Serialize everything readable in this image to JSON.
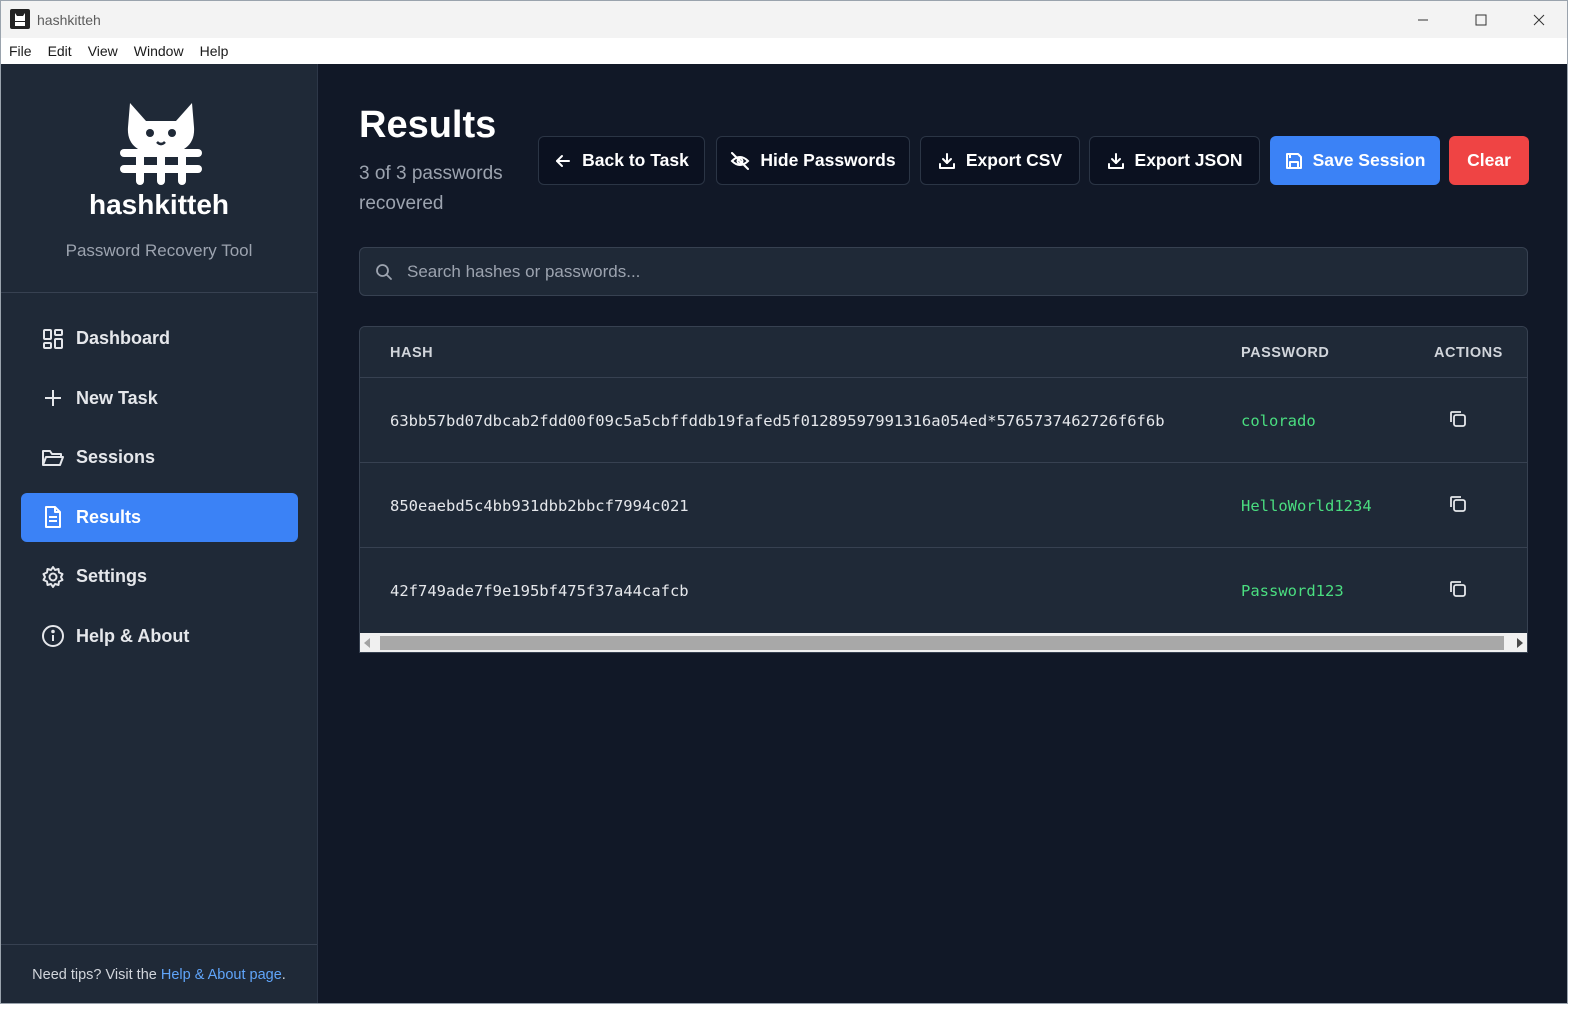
{
  "window": {
    "title": "hashkitteh"
  },
  "menu": [
    "File",
    "Edit",
    "View",
    "Window",
    "Help"
  ],
  "sidebar": {
    "brand_name": "hashkitteh",
    "brand_subtitle": "Password Recovery Tool",
    "items": [
      {
        "label": "Dashboard",
        "icon": "grid-icon",
        "active": false
      },
      {
        "label": "New Task",
        "icon": "plus-icon",
        "active": false
      },
      {
        "label": "Sessions",
        "icon": "folder-icon",
        "active": false
      },
      {
        "label": "Results",
        "icon": "document-icon",
        "active": true
      },
      {
        "label": "Settings",
        "icon": "gear-icon",
        "active": false
      },
      {
        "label": "Help & About",
        "icon": "info-icon",
        "active": false
      }
    ],
    "footer_text": "Need tips? Visit the ",
    "footer_link": "Help & About page",
    "footer_end": "."
  },
  "main": {
    "title": "Results",
    "subtitle": "3 of 3 passwords recovered",
    "buttons": {
      "back": "Back to Task",
      "hide": "Hide Passwords",
      "export_csv": "Export CSV",
      "export_json": "Export JSON",
      "save": "Save Session",
      "clear": "Clear"
    },
    "search": {
      "placeholder": "Search hashes or passwords..."
    },
    "table": {
      "columns": {
        "hash": "HASH",
        "password": "PASSWORD",
        "actions": "ACTIONS"
      },
      "rows": [
        {
          "hash": "63bb57bd07dbcab2fdd00f09c5a5cbffddb19fafed5f01289597991316a054ed*5765737462726f6f6b",
          "password": "colorado"
        },
        {
          "hash": "850eaebd5c4bb931dbb2bbcf7994c021",
          "password": "HelloWorld1234"
        },
        {
          "hash": "42f749ade7f9e195bf475f37a44cafcb",
          "password": "Password123"
        }
      ]
    }
  },
  "colors": {
    "accent": "#3b82f6",
    "danger": "#ef4444",
    "password_text": "#4ade80",
    "sidebar_bg": "#1f2937",
    "main_bg": "#111827"
  }
}
